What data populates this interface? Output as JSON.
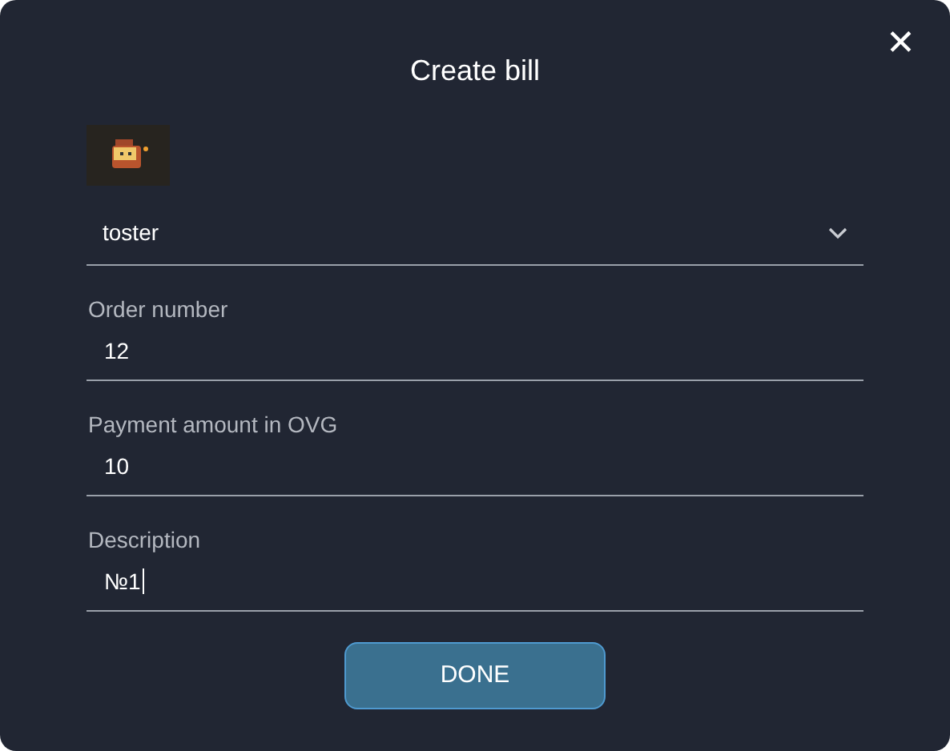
{
  "dialog": {
    "title": "Create bill",
    "close": "✕"
  },
  "fields": [
    {
      "kind": "select",
      "value": "toster"
    },
    {
      "kind": "text",
      "label": "Order number",
      "value": "12",
      "focused": false
    },
    {
      "kind": "text",
      "label": "Payment amount in OVG",
      "value": "10",
      "focused": false
    },
    {
      "kind": "text",
      "label": "Description",
      "value": "№1",
      "focused": true
    }
  ],
  "button": "DONE"
}
